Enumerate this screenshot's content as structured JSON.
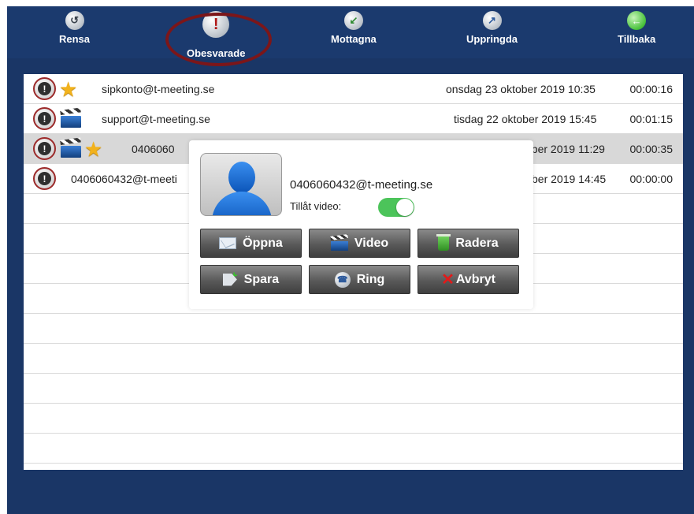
{
  "toolbar": {
    "items": [
      {
        "label": "Rensa",
        "icon": "clear-history-icon"
      },
      {
        "label": "Obesvarade",
        "icon": "missed-call-icon"
      },
      {
        "label": "Mottagna",
        "icon": "received-call-icon"
      },
      {
        "label": "Uppringda",
        "icon": "dialed-call-icon"
      },
      {
        "label": "Tillbaka",
        "icon": "back-arrow-icon"
      }
    ],
    "active": "Obesvarade",
    "highlight_color": "#7c1619"
  },
  "calls": [
    {
      "address": "sipkonto@t-meeting.se",
      "date": "onsdag 23 oktober 2019 10:35",
      "duration": "00:00:16",
      "favorite": true,
      "video": false
    },
    {
      "address": "support@t-meeting.se",
      "date": "tisdag 22 oktober 2019 15:45",
      "duration": "00:01:15",
      "favorite": false,
      "video": true
    },
    {
      "address": "0406060",
      "date": "ober 2019 11:29",
      "duration": "00:00:35",
      "favorite": true,
      "video": true,
      "selected": true
    },
    {
      "address": "0406060432@t-meeti",
      "date": "ber 2019 14:45",
      "duration": "00:00:00",
      "favorite": false,
      "video": false
    }
  ],
  "popup": {
    "address": "0406060432@t-meeting.se",
    "video_label": "Tillåt video:",
    "video_enabled": true,
    "buttons": [
      {
        "label": "Öppna",
        "icon": "envelope-icon"
      },
      {
        "label": "Video",
        "icon": "clapperboard-icon"
      },
      {
        "label": "Radera",
        "icon": "trash-icon"
      },
      {
        "label": "Spara",
        "icon": "tag-add-icon"
      },
      {
        "label": "Ring",
        "icon": "phone-icon"
      },
      {
        "label": "Avbryt",
        "icon": "close-icon"
      }
    ]
  },
  "colors": {
    "toolbar": "#1b3a6e",
    "toggle_on": "#4cc45a",
    "selected_row": "#d8d8d8"
  }
}
